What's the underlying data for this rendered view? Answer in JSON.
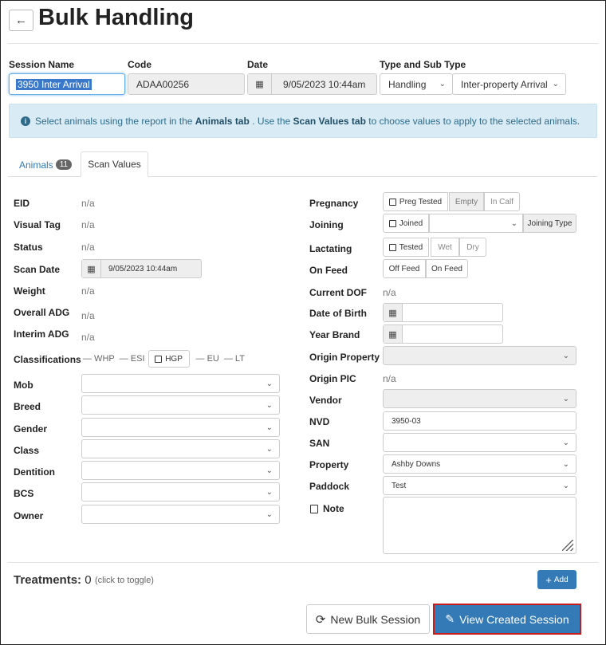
{
  "header": {
    "back_icon": "←",
    "title": "Bulk Handling"
  },
  "session": {
    "name_label": "Session Name",
    "name_value": "3950 Inter Arrival",
    "code_label": "Code",
    "code_value": "ADAA00256",
    "date_label": "Date",
    "date_value": "9/05/2023 10:44am",
    "type_label": "Type and Sub Type",
    "type_value": "Handling",
    "subtype_value": "Inter-property Arrival"
  },
  "info": {
    "icon": "i",
    "part1": "Select animals using the report in the ",
    "bold1": "Animals tab",
    "part2": " . Use the ",
    "bold2": "Scan Values tab",
    "part3": " to choose values to apply to the selected animals."
  },
  "tabs": {
    "animals_label": "Animals",
    "animals_count": "11",
    "scan_label": "Scan Values"
  },
  "left": {
    "eid_label": "EID",
    "eid_value": "n/a",
    "visual_tag_label": "Visual Tag",
    "visual_tag_value": "n/a",
    "status_label": "Status",
    "status_value": "n/a",
    "scan_date_label": "Scan Date",
    "scan_date_value": "9/05/2023 10:44am",
    "weight_label": "Weight",
    "weight_value": "n/a",
    "overall_adg_label": "Overall ADG",
    "overall_adg_value": "n/a",
    "interim_adg_label": "Interim ADG",
    "interim_adg_value": "n/a",
    "classifications_label": "Classifications",
    "class_whp": "— WHP",
    "class_esi": "— ESI",
    "class_hgp": "HGP",
    "class_eu": "— EU",
    "class_lt": "— LT",
    "mob_label": "Mob",
    "breed_label": "Breed",
    "gender_label": "Gender",
    "class_label": "Class",
    "dentition_label": "Dentition",
    "bcs_label": "BCS",
    "owner_label": "Owner"
  },
  "right": {
    "pregnancy_label": "Pregnancy",
    "preg_tested": "Preg Tested",
    "empty": "Empty",
    "in_calf": "In Calf",
    "joining_label": "Joining",
    "joined": "Joined",
    "joining_type": "Joining Type",
    "lactating_label": "Lactating",
    "tested": "Tested",
    "wet": "Wet",
    "dry": "Dry",
    "on_feed_label": "On Feed",
    "off_feed": "Off Feed",
    "on_feed_btn": "On Feed",
    "current_dof_label": "Current DOF",
    "current_dof_value": "n/a",
    "dob_label": "Date of Birth",
    "year_brand_label": "Year Brand",
    "origin_property_label": "Origin Property",
    "origin_pic_label": "Origin PIC",
    "origin_pic_value": "n/a",
    "vendor_label": "Vendor",
    "nvd_label": "NVD",
    "nvd_value": "3950-03",
    "san_label": "SAN",
    "property_label": "Property",
    "property_value": "Ashby Downs",
    "paddock_label": "Paddock",
    "paddock_value": "Test",
    "note_label": "Note"
  },
  "treatments": {
    "label": "Treatments:",
    "count": "0",
    "hint": "(click to toggle)",
    "add_label": "Add"
  },
  "footer": {
    "new_label": "New Bulk Session",
    "view_label": "View Created Session"
  },
  "icons": {
    "calendar": "calendar-icon",
    "chevron": "chevron-down-icon",
    "refresh": "refresh-icon",
    "pencil": "pencil-icon",
    "plus": "plus-icon",
    "note": "note-icon",
    "back": "arrow-left-icon"
  },
  "colors": {
    "primary": "#337ab7",
    "info_bg": "#d9ecf5",
    "highlight_border": "#c81d1d"
  }
}
